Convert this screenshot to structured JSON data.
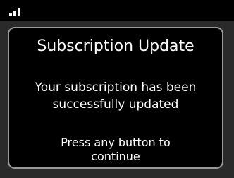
{
  "status_bar": {
    "signal_icon": "signal-strength-icon"
  },
  "dialog": {
    "title": "Subscription Update",
    "message_line1": "Your subscription has been",
    "message_line2": "successfully updated",
    "prompt_line1": "Press any button to",
    "prompt_line2": "continue"
  },
  "colors": {
    "background": "#000000",
    "backdrop": "#2a2a2a",
    "dialog_border": "#9a9a9a",
    "text": "#ffffff"
  }
}
